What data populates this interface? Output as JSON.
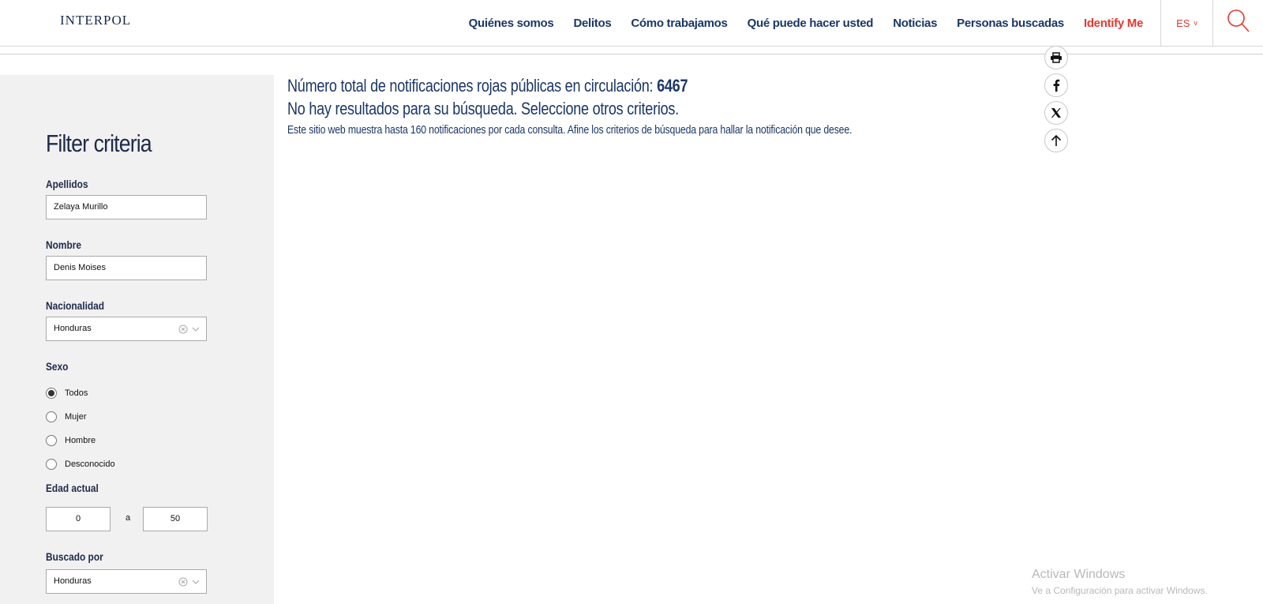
{
  "header": {
    "logo": "INTERPOL",
    "nav": [
      {
        "label": "Quiénes somos"
      },
      {
        "label": "Delitos"
      },
      {
        "label": "Cómo trabajamos"
      },
      {
        "label": "Qué puede hacer usted"
      },
      {
        "label": "Noticias"
      },
      {
        "label": "Personas buscadas"
      },
      {
        "label": "Identify Me"
      }
    ],
    "lang": "ES",
    "lang_chevron": "v"
  },
  "sidebar": {
    "title": "Filter criteria",
    "surname_label": "Apellidos",
    "surname_value": "Zelaya Murillo",
    "name_label": "Nombre",
    "name_value": "Denis  Moises",
    "nationality_label": "Nacionalidad",
    "nationality_value": "Honduras",
    "sex_label": "Sexo",
    "sex_options": [
      {
        "label": "Todos",
        "selected": true
      },
      {
        "label": "Mujer",
        "selected": false
      },
      {
        "label": "Hombre",
        "selected": false
      },
      {
        "label": "Desconocido",
        "selected": false
      }
    ],
    "age_label": "Edad actual",
    "age_from": "0",
    "age_sep": "a",
    "age_to": "50",
    "wanted_by_label": "Buscado por",
    "wanted_by_value": "Honduras"
  },
  "results": {
    "total_text": "Número total de notificaciones rojas públicas en circulación: ",
    "total_count": "6467",
    "no_results": "No hay resultados para su búsqueda. Seleccione otros criterios.",
    "info": "Este sitio web muestra hasta 160 notificaciones por cada consulta. Afine los criterios de búsqueda para hallar la notificación que desee."
  },
  "share_icons": [
    "print-icon",
    "facebook-icon",
    "x-icon",
    "arrow-up-icon"
  ],
  "watermark": {
    "line1": "Activar Windows",
    "line2": "Ve a Configuración para activar Windows."
  },
  "colors": {
    "navy": "#1b3766",
    "accent_red": "#e5382e",
    "sidebar_bg": "#f1f1f1"
  }
}
